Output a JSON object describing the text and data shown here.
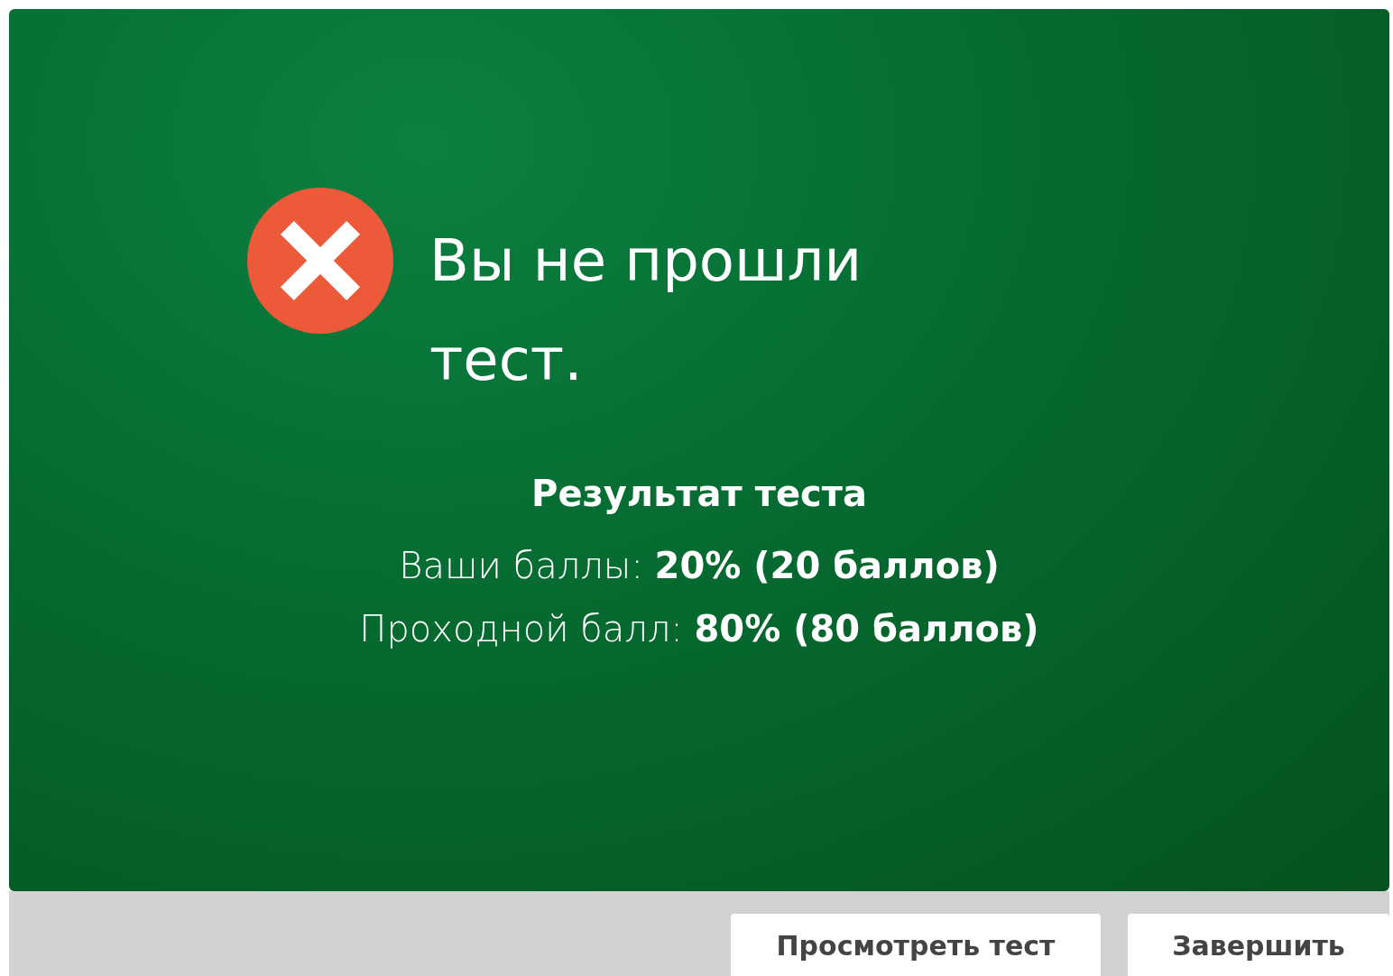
{
  "result": {
    "passed": false,
    "title": "Вы не прошли тест.",
    "subtitle": "Результат теста",
    "lines": [
      {
        "label": "Ваши баллы:",
        "value": "20% (20 баллов)"
      },
      {
        "label": "Проходной балл:",
        "value": "80% (80 баллов)"
      }
    ]
  },
  "buttons": [
    "Просмотреть тест",
    "Завершить"
  ]
}
